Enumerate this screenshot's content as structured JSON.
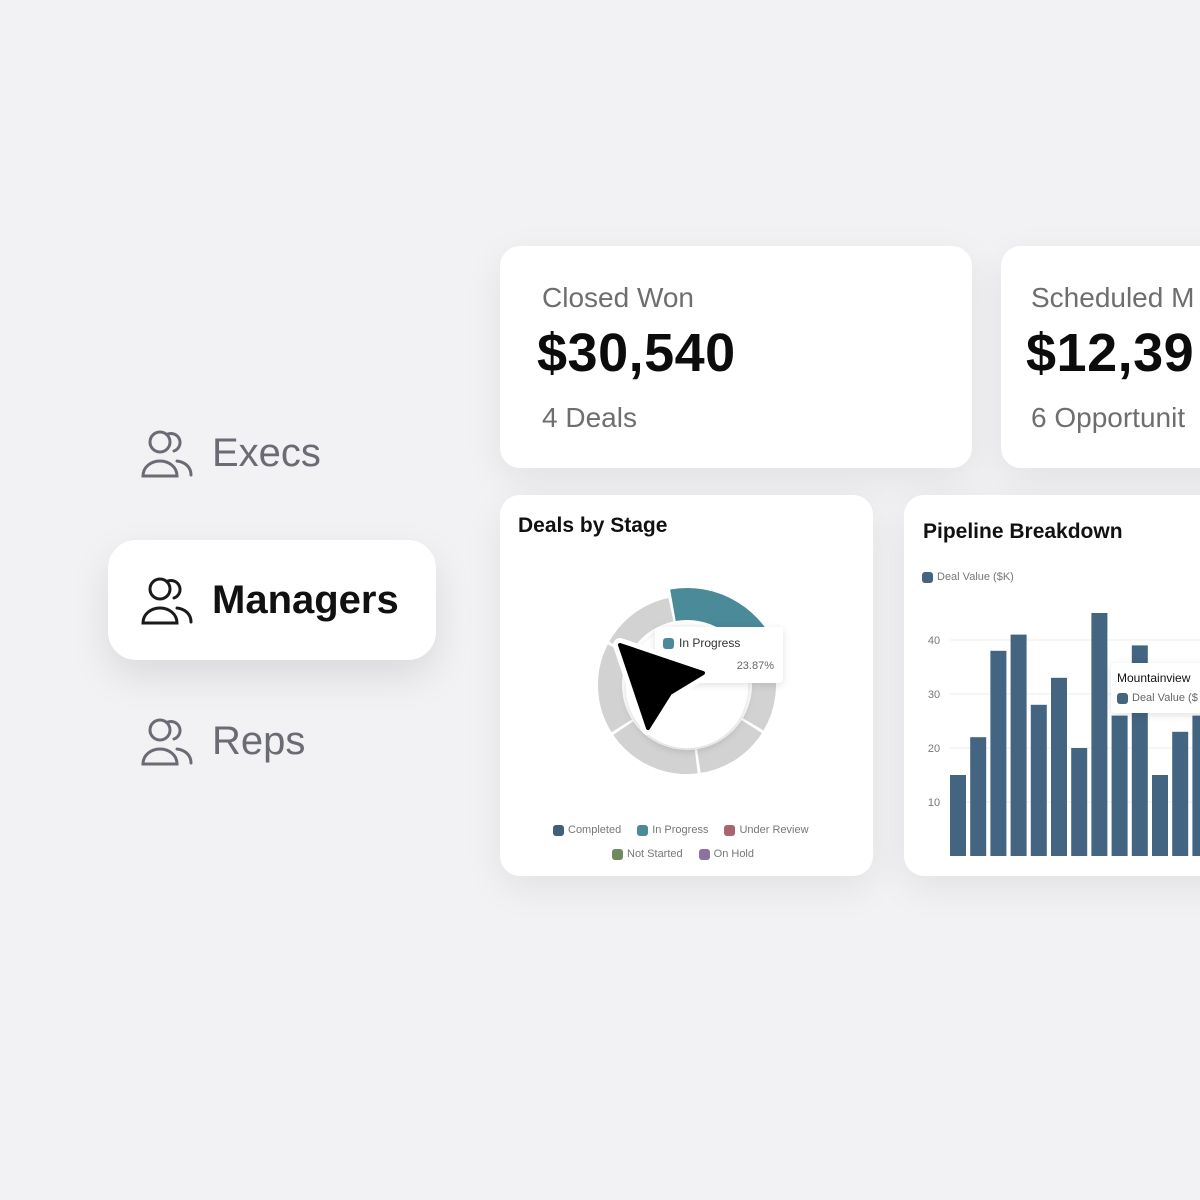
{
  "roles": [
    {
      "label": "Execs",
      "active": false
    },
    {
      "label": "Managers",
      "active": true
    },
    {
      "label": "Reps",
      "active": false
    }
  ],
  "kpis": [
    {
      "title": "Closed Won",
      "value": "$30,540",
      "sub": "4 Deals"
    },
    {
      "title": "Scheduled M",
      "value": "$12,39",
      "sub": "6 Opportunit"
    }
  ],
  "deals_by_stage": {
    "title": "Deals by Stage",
    "tooltip": {
      "label": "In Progress",
      "value": "23.87%"
    },
    "legend": [
      {
        "label": "Completed",
        "color": "#3f5f7b"
      },
      {
        "label": "In Progress",
        "color": "#4b8a99"
      },
      {
        "label": "Under Review",
        "color": "#a8656d"
      },
      {
        "label": "Not Started",
        "color": "#6f8a5c"
      },
      {
        "label": "On Hold",
        "color": "#8c72a0"
      }
    ]
  },
  "pipeline": {
    "title": "Pipeline Breakdown",
    "legend_label": "Deal Value ($K)",
    "tooltip": {
      "title": "Mountainview",
      "series": "Deal Value ($"
    }
  },
  "chart_data": [
    {
      "type": "pie",
      "title": "Deals by Stage",
      "series": [
        {
          "name": "In Progress",
          "values": [
            23.87
          ]
        }
      ],
      "segments": [
        {
          "label": "In Progress",
          "percent": 23.87,
          "highlighted": true,
          "color": "#4b8a99"
        },
        {
          "label": "",
          "percent": 13,
          "color": "#d2d2d2"
        },
        {
          "label": "",
          "percent": 14,
          "color": "#d2d2d2"
        },
        {
          "label": "",
          "percent": 18,
          "color": "#d2d2d2"
        },
        {
          "label": "",
          "percent": 17,
          "color": "#d2d2d2"
        },
        {
          "label": "",
          "percent": 14.13,
          "color": "#d2d2d2"
        }
      ],
      "legend": [
        "Completed",
        "In Progress",
        "Under Review",
        "Not Started",
        "On Hold"
      ],
      "legend_placement": "bottom"
    },
    {
      "type": "bar",
      "title": "Pipeline Breakdown",
      "series": [
        {
          "name": "Deal Value ($K)",
          "values": [
            15,
            22,
            38,
            41,
            28,
            33,
            20,
            45,
            26,
            39,
            15,
            23,
            26
          ]
        }
      ],
      "tooltip_bar_value": 39,
      "yticks": [
        10,
        20,
        30,
        40
      ],
      "ylim": [
        0,
        50
      ],
      "grid": true,
      "bar_color": "#436582",
      "legend_placement": "top-left"
    }
  ]
}
